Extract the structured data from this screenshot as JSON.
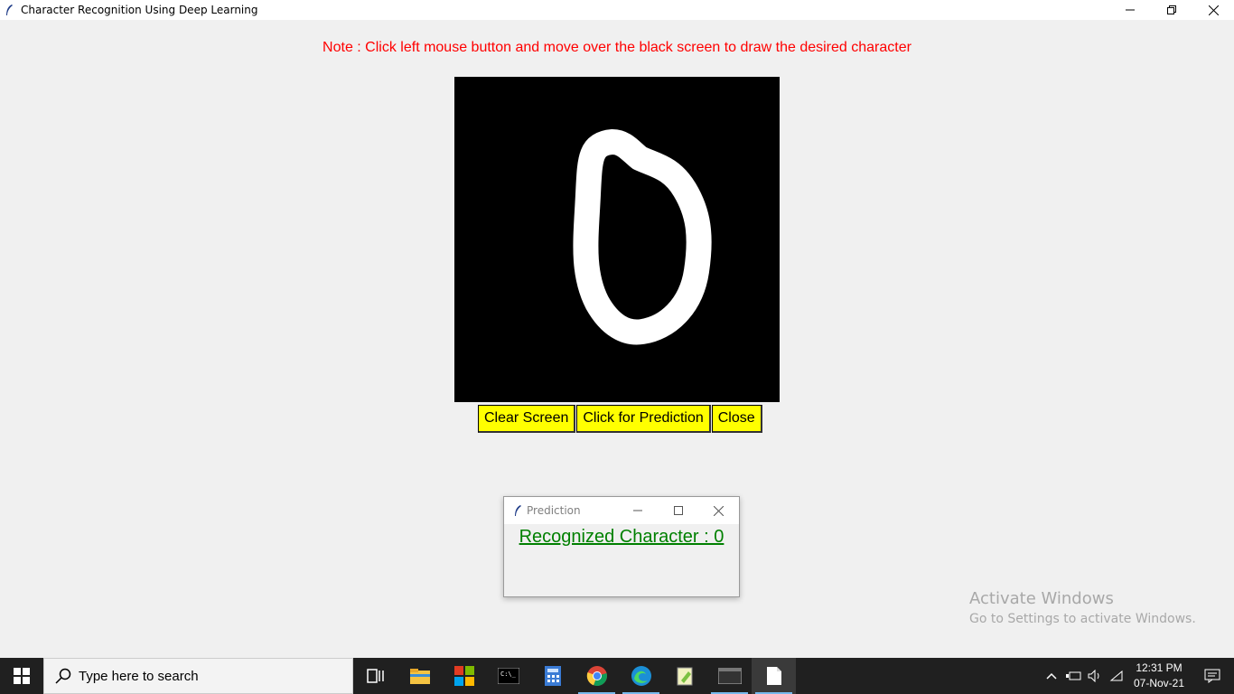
{
  "window": {
    "title": "Character Recognition Using Deep Learning",
    "note": "Note : Click left mouse button and move over the black screen to draw the desired character"
  },
  "buttons": {
    "clear": "Clear Screen",
    "predict": "Click for Prediction",
    "close": "Close"
  },
  "prediction_popup": {
    "title": "Prediction",
    "result": "Recognized Character :  0"
  },
  "watermark": {
    "line1": "Activate Windows",
    "line2": "Go to Settings to activate Windows."
  },
  "taskbar": {
    "search_placeholder": "Type here to search",
    "time": "12:31 PM",
    "date": "07-Nov-21",
    "apps": [
      "task-view-icon",
      "file-explorer-icon",
      "office-icon",
      "terminal-icon",
      "calculator-icon",
      "chrome-icon",
      "edge-icon",
      "notepadpp-icon",
      "console-icon",
      "document-icon"
    ]
  },
  "colors": {
    "note": "#ff0000",
    "button_bg": "#ffff00",
    "result": "#008000",
    "canvas": "#000000",
    "stroke": "#ffffff"
  },
  "canvas": {
    "drawn_character": "0"
  }
}
